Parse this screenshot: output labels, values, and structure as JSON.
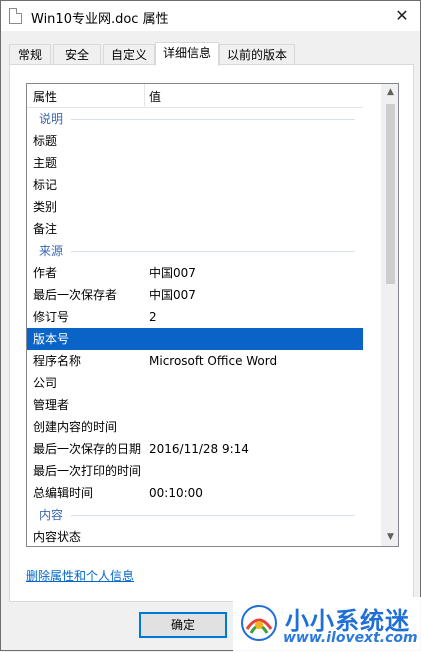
{
  "window": {
    "title": "Win10专业网.doc 属性",
    "close_glyph": "✕"
  },
  "tabs": [
    {
      "label": "常规"
    },
    {
      "label": "安全"
    },
    {
      "label": "自定义"
    },
    {
      "label": "详细信息",
      "active": true
    },
    {
      "label": "以前的版本"
    }
  ],
  "list": {
    "columns": [
      "属性",
      "值"
    ],
    "rows": [
      {
        "type": "group",
        "key": "说明"
      },
      {
        "key": "标题",
        "value": ""
      },
      {
        "key": "主题",
        "value": ""
      },
      {
        "key": "标记",
        "value": ""
      },
      {
        "key": "类别",
        "value": ""
      },
      {
        "key": "备注",
        "value": ""
      },
      {
        "type": "group",
        "key": "来源"
      },
      {
        "key": "作者",
        "value": "中国007"
      },
      {
        "key": "最后一次保存者",
        "value": "中国007"
      },
      {
        "key": "修订号",
        "value": "2"
      },
      {
        "key": "版本号",
        "value": "",
        "selected": true
      },
      {
        "key": "程序名称",
        "value": "Microsoft Office Word"
      },
      {
        "key": "公司",
        "value": ""
      },
      {
        "key": "管理者",
        "value": ""
      },
      {
        "key": "创建内容的时间",
        "value": ""
      },
      {
        "key": "最后一次保存的日期",
        "value": "2016/11/28 9:14"
      },
      {
        "key": "最后一次打印的时间",
        "value": ""
      },
      {
        "key": "总编辑时间",
        "value": "00:10:00"
      },
      {
        "type": "group",
        "key": "内容"
      },
      {
        "key": "内容状态",
        "value": ""
      }
    ]
  },
  "remove_link": "删除属性和个人信息",
  "buttons": {
    "ok": "确定"
  },
  "watermark": {
    "title": "小小系统迷",
    "url": "www.ilovext.com"
  },
  "colors": {
    "selection": "#0a64c8",
    "group_text": "#3a67b5",
    "link": "#0066cc"
  }
}
